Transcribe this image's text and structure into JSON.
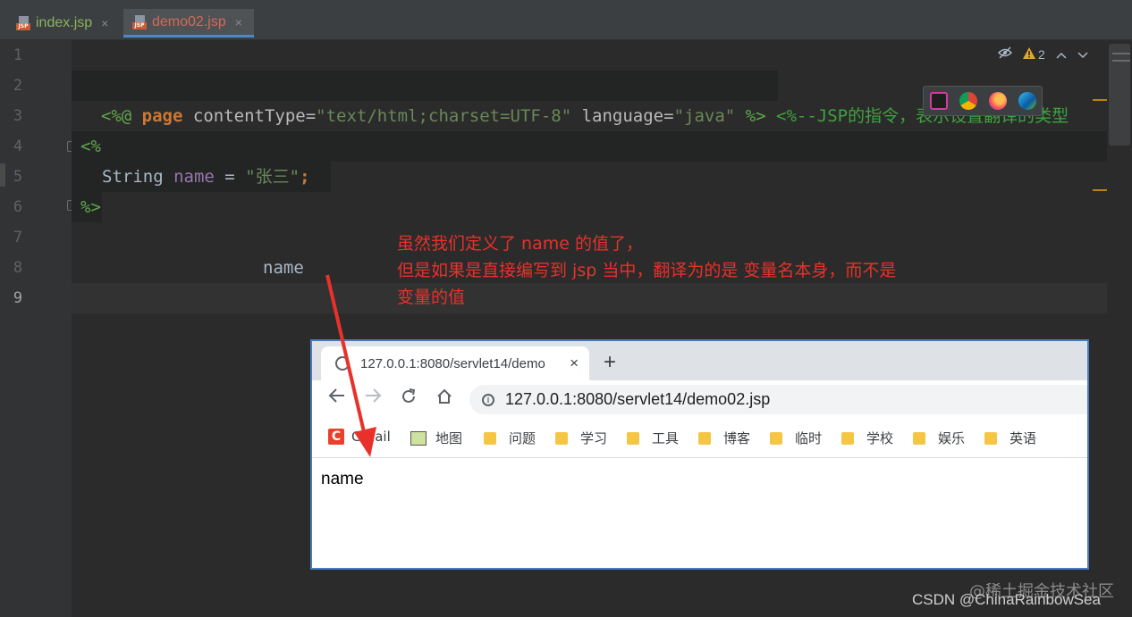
{
  "tabs": [
    {
      "name": "index.jsp",
      "active": false
    },
    {
      "name": "demo02.jsp",
      "active": true
    }
  ],
  "tab_badge": "JSP",
  "close_glyph": "×",
  "line_numbers": [
    "1",
    "2",
    "3",
    "4",
    "5",
    "6",
    "7",
    "8",
    "9"
  ],
  "code": {
    "line2": {
      "open": "<%@",
      "kw": "page",
      "attr1": "contentType=",
      "val1": "\"text/html;charset=UTF-8\"",
      "attr2": "language=",
      "val2": "\"java\"",
      "close": "%>",
      "comment": "<%--JSP的指令，表示设置翻译的类型"
    },
    "line4": "<%",
    "line5": {
      "type": "String",
      "var": "name",
      "op": " = ",
      "str": "\"张三\"",
      "end": ";"
    },
    "line6": "%>",
    "line8": "name"
  },
  "inspection": {
    "warning_count": "2"
  },
  "annotation": [
    "虽然我们定义了 name 的值了，",
    "但是如果是直接编写到 jsp 当中，翻译为的是 变量名本身，而不是",
    "变量的值"
  ],
  "browser": {
    "tab_title": "127.0.0.1:8080/servlet14/demo",
    "url": "127.0.0.1:8080/servlet14/demo02.jsp",
    "new_tab": "+",
    "bookmarks": [
      "Gmail",
      "地图",
      "问题",
      "学习",
      "工具",
      "博客",
      "临时",
      "学校",
      "娱乐",
      "英语"
    ],
    "page_text": "name"
  },
  "watermark": "@稀土掘金技术社区",
  "credit": "CSDN @ChinaRainbowSea",
  "colors": {
    "annotation": "#e8312a",
    "arrow": "#e8312a",
    "browser_border": "#4b7bbf"
  }
}
